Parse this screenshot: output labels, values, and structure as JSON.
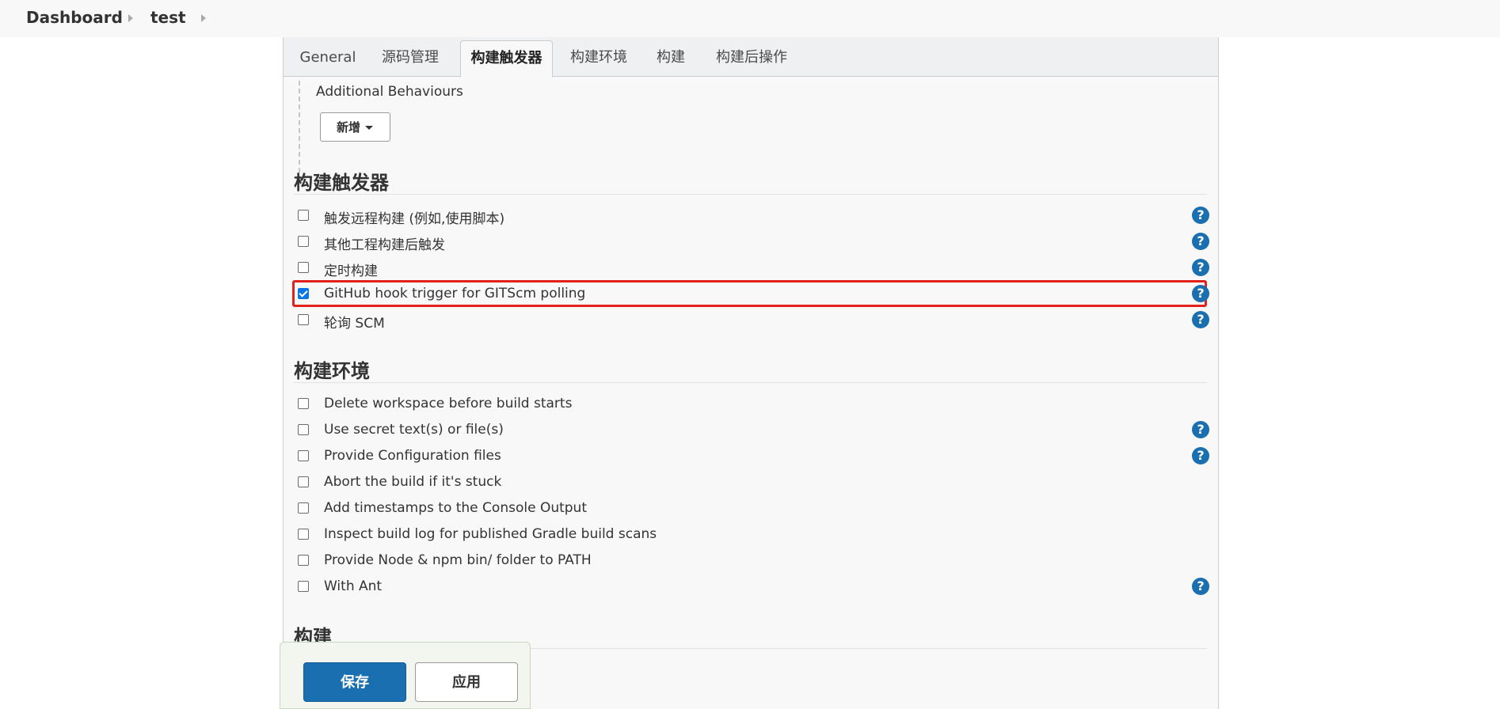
{
  "breadcrumb": {
    "items": [
      {
        "label": "Dashboard"
      },
      {
        "label": "test"
      }
    ]
  },
  "tabs": [
    {
      "label": "General"
    },
    {
      "label": "源码管理"
    },
    {
      "label": "构建触发器",
      "active": true
    },
    {
      "label": "构建环境"
    },
    {
      "label": "构建"
    },
    {
      "label": "构建后操作"
    }
  ],
  "additional_behaviours": {
    "label": "Additional Behaviours",
    "add_button": "新增"
  },
  "triggers": {
    "title": "构建触发器",
    "options": [
      {
        "label": "触发远程构建 (例如,使用脚本)",
        "checked": false,
        "help": true
      },
      {
        "label": "其他工程构建后触发",
        "checked": false,
        "help": true
      },
      {
        "label": "定时构建",
        "checked": false,
        "help": true
      },
      {
        "label": "GitHub hook trigger for GITScm polling",
        "checked": true,
        "help": true,
        "highlighted": true
      },
      {
        "label": "轮询 SCM",
        "checked": false,
        "help": true
      }
    ]
  },
  "environment": {
    "title": "构建环境",
    "options": [
      {
        "label": "Delete workspace before build starts",
        "checked": false,
        "help": false
      },
      {
        "label": "Use secret text(s) or file(s)",
        "checked": false,
        "help": true
      },
      {
        "label": "Provide Configuration files",
        "checked": false,
        "help": true
      },
      {
        "label": "Abort the build if it's stuck",
        "checked": false,
        "help": false
      },
      {
        "label": "Add timestamps to the Console Output",
        "checked": false,
        "help": false
      },
      {
        "label": "Inspect build log for published Gradle build scans",
        "checked": false,
        "help": false
      },
      {
        "label": "Provide Node & npm bin/ folder to PATH",
        "checked": false,
        "help": false
      },
      {
        "label": "With Ant",
        "checked": false,
        "help": true
      }
    ]
  },
  "build": {
    "title": "构建"
  },
  "help_icon_glyph": "?",
  "actions": {
    "save_label": "保存",
    "apply_label": "应用"
  },
  "colors": {
    "primary": "#1a6fb0",
    "highlight": "#e3211b",
    "checkbox_checked": "#0a75e5"
  }
}
